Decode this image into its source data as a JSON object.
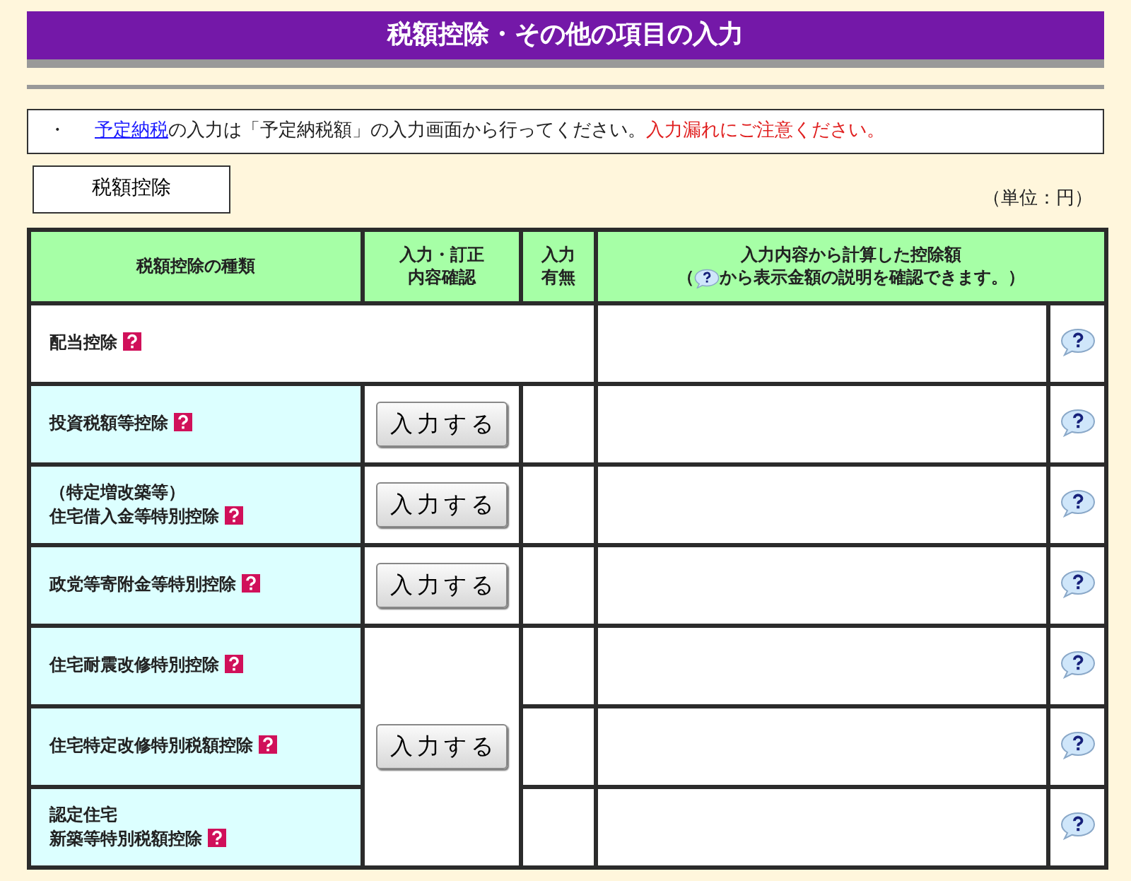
{
  "title": "税額控除・その他の項目の入力",
  "notice": {
    "bullet": "・",
    "link": "予定納税",
    "text": "の入力は「予定納税額」の入力画面から行ってください。",
    "warning": "入力漏れにご注意ください。"
  },
  "section_button": "税額控除",
  "unit": "（単位：円）",
  "table": {
    "columns": [
      {
        "lines": [
          "税額控除の種類"
        ]
      },
      {
        "lines": [
          "入力・訂正",
          "内容確認"
        ]
      },
      {
        "lines": [
          "入力",
          "有無"
        ]
      },
      {
        "lines": [
          "入力内容から計算した控除額"
        ],
        "note_before": "（",
        "note_after": "から表示金額の説明を確認できます。）"
      }
    ],
    "rows": [
      {
        "kind": "plain",
        "lines": [
          "配当控除"
        ]
      },
      {
        "kind": "input",
        "lines": [
          "投資税額等控除"
        ],
        "button": "入力する"
      },
      {
        "kind": "input",
        "lines": [
          "（特定増改築等）",
          "住宅借入金等特別控除"
        ],
        "button": "入力する"
      },
      {
        "kind": "input",
        "lines": [
          "政党等寄附金等特別控除"
        ],
        "button": "入力する"
      },
      {
        "kind": "group",
        "button": "入力する",
        "rows": [
          {
            "lines": [
              "住宅耐震改修特別控除"
            ]
          },
          {
            "lines": [
              "住宅特定改修特別税額控除"
            ]
          },
          {
            "lines": [
              "認定住宅",
              "新築等特別税額控除"
            ]
          }
        ]
      }
    ]
  }
}
